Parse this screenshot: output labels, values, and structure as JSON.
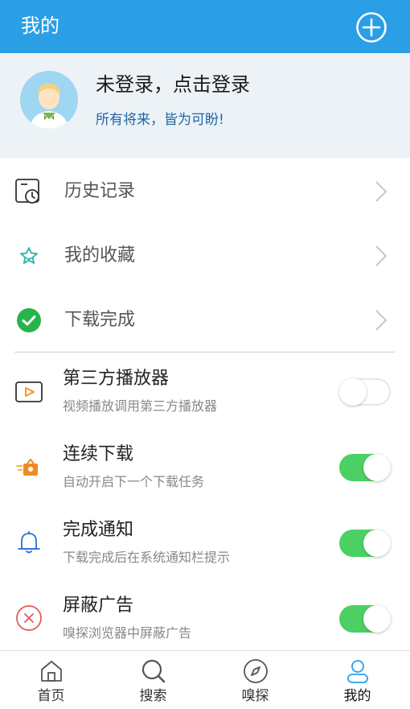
{
  "header": {
    "title": "我的",
    "add_icon": "plus-circle-icon"
  },
  "profile": {
    "name": "未登录，点击登录",
    "motto": "所有将来，皆为可盼!",
    "avatar_icon": "user-avatar-icon"
  },
  "nav_items": [
    {
      "label": "历史记录",
      "icon": "history-icon"
    },
    {
      "label": "我的收藏",
      "icon": "star-icon"
    },
    {
      "label": "下载完成",
      "icon": "check-circle-icon"
    }
  ],
  "settings": [
    {
      "title": "第三方播放器",
      "desc": "视频播放调用第三方播放器",
      "enabled": false,
      "icon": "player-icon"
    },
    {
      "title": "连续下载",
      "desc": "自动开启下一个下载任务",
      "enabled": true,
      "icon": "download-box-icon"
    },
    {
      "title": "完成通知",
      "desc": "下载完成后在系统通知栏提示",
      "enabled": true,
      "icon": "bell-icon"
    },
    {
      "title": "屏蔽广告",
      "desc": "嗅探浏览器中屏蔽广告",
      "enabled": true,
      "icon": "block-icon"
    }
  ],
  "tabs": [
    {
      "label": "首页",
      "icon": "home-icon"
    },
    {
      "label": "搜索",
      "icon": "search-icon"
    },
    {
      "label": "嗅探",
      "icon": "compass-icon"
    },
    {
      "label": "我的",
      "icon": "profile-icon",
      "active": true
    }
  ],
  "colors": {
    "header_bg": "#2a9fe6",
    "toggle_on": "#4cd063",
    "profile_bg": "#edf2f6",
    "accent_link": "#1f66a8"
  }
}
